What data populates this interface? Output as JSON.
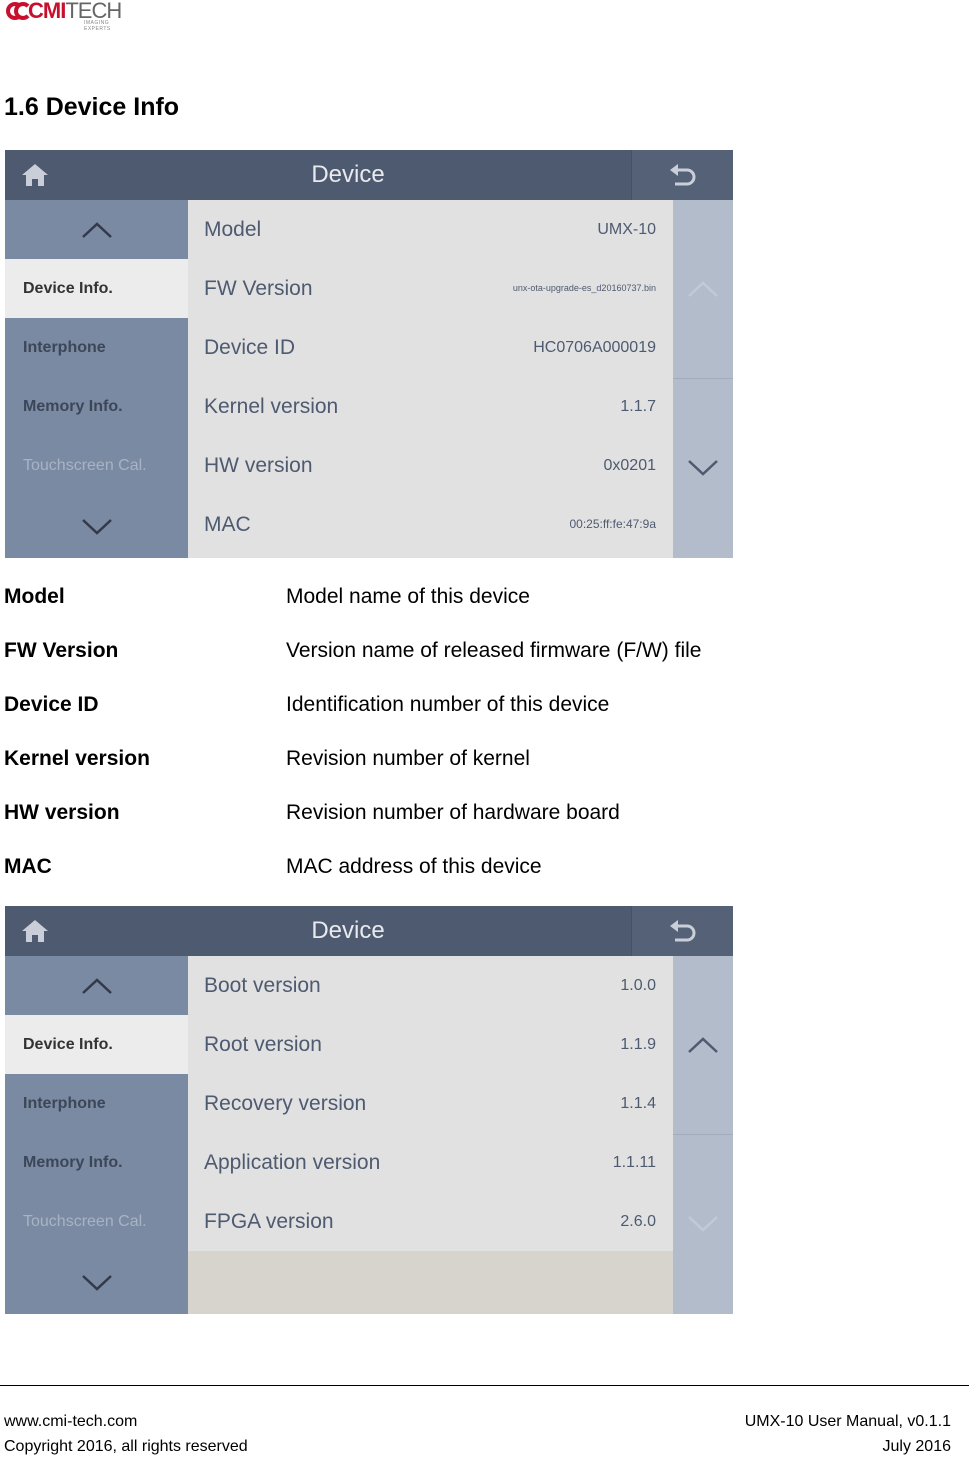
{
  "logo": {
    "part1": "CMI",
    "part2": "TECH",
    "sub": "IMAGING EXPERTS"
  },
  "section_title": "1.6 Device Info",
  "screen1": {
    "header_title": "Device",
    "sidebar": [
      {
        "label": ""
      },
      {
        "label": "Device Info."
      },
      {
        "label": "Interphone"
      },
      {
        "label": "Memory Info."
      },
      {
        "label": "Touchscreen Cal."
      },
      {
        "label": ""
      }
    ],
    "rows": [
      {
        "label": "Model",
        "value": "UMX-10"
      },
      {
        "label": "FW Version",
        "value": "unx-ota-upgrade-es_d20160737.bin"
      },
      {
        "label": "Device ID",
        "value": "HC0706A000019"
      },
      {
        "label": "Kernel version",
        "value": "1.1.7"
      },
      {
        "label": "HW version",
        "value": "0x0201"
      },
      {
        "label": "MAC",
        "value": "00:25:ff:fe:47:9a"
      }
    ]
  },
  "definitions": [
    {
      "term": "Model",
      "desc": "Model name of this device"
    },
    {
      "term": "FW Version",
      "desc": "Version name of released firmware (F/W) file"
    },
    {
      "term": "Device ID",
      "desc": "Identification number of this device"
    },
    {
      "term": "Kernel version",
      "desc": "Revision number of kernel"
    },
    {
      "term": "HW version",
      "desc": "Revision number of hardware board"
    },
    {
      "term": "MAC",
      "desc": "MAC address of this device"
    }
  ],
  "screen2": {
    "header_title": "Device",
    "sidebar": [
      {
        "label": ""
      },
      {
        "label": "Device Info."
      },
      {
        "label": "Interphone"
      },
      {
        "label": "Memory Info."
      },
      {
        "label": "Touchscreen Cal."
      },
      {
        "label": ""
      }
    ],
    "rows": [
      {
        "label": "Boot version",
        "value": "1.0.0"
      },
      {
        "label": "Root version",
        "value": "1.1.9"
      },
      {
        "label": "Recovery version",
        "value": "1.1.4"
      },
      {
        "label": "Application version",
        "value": "1.1.11"
      },
      {
        "label": "FPGA version",
        "value": "2.6.0"
      }
    ]
  },
  "footer": {
    "website": "www.cmi-tech.com",
    "copyright": "Copyright 2016, all rights reserved",
    "manual": "UMX-10 User Manual, v0.1.1",
    "date": "July 2016"
  },
  "colors": {
    "header": "#4e5a70",
    "sidebar": "#7a8aa2",
    "row_bg": "#e1e1e1",
    "scrollbar": "#b3bccb",
    "brand_red": "#c8102e"
  }
}
